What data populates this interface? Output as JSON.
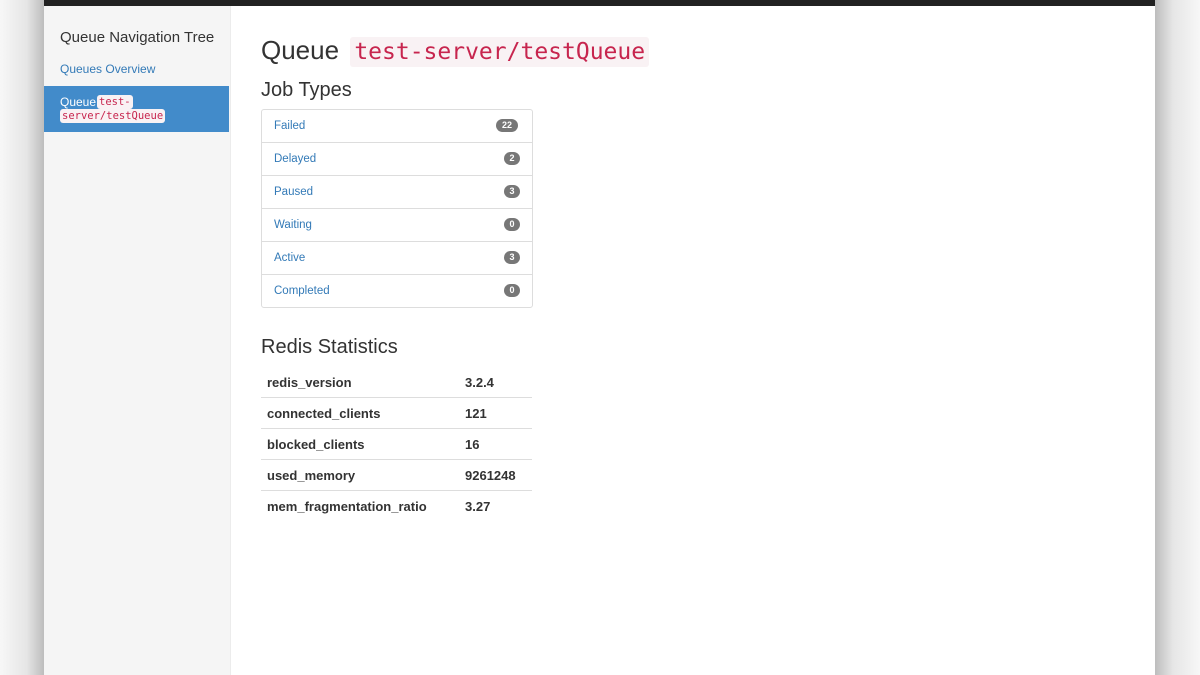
{
  "sidebar": {
    "title": "Queue Navigation Tree",
    "overview_link": "Queues Overview",
    "active_item": {
      "label": "Queue",
      "code_line1": "test-",
      "code_line2": "server/testQueue"
    }
  },
  "main": {
    "title_prefix": "Queue",
    "queue_name": "test-server/testQueue",
    "job_types_heading": "Job Types",
    "job_types": [
      {
        "label": "Failed",
        "count": "22"
      },
      {
        "label": "Delayed",
        "count": "2"
      },
      {
        "label": "Paused",
        "count": "3"
      },
      {
        "label": "Waiting",
        "count": "0"
      },
      {
        "label": "Active",
        "count": "3"
      },
      {
        "label": "Completed",
        "count": "0"
      }
    ],
    "redis_heading": "Redis Statistics",
    "redis_stats": [
      {
        "key": "redis_version",
        "value": "3.2.4"
      },
      {
        "key": "connected_clients",
        "value": "121"
      },
      {
        "key": "blocked_clients",
        "value": "16"
      },
      {
        "key": "used_memory",
        "value": "9261248"
      },
      {
        "key": "mem_fragmentation_ratio",
        "value": "3.27"
      }
    ]
  },
  "colors": {
    "link": "#337ab7",
    "active_bg": "#428bca",
    "code_text": "#c7254e",
    "code_bg": "#f9f2f4",
    "badge_bg": "#777777",
    "topbar": "#222222"
  }
}
